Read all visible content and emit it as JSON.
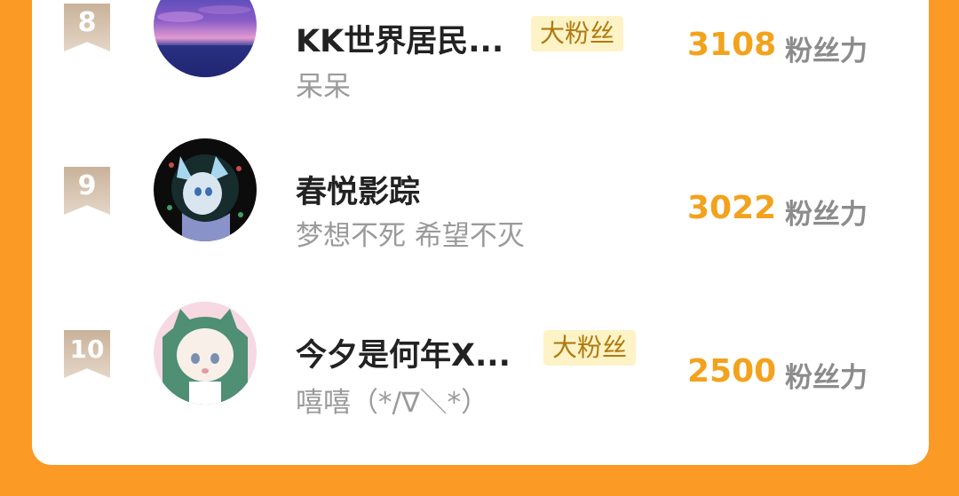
{
  "ranking": [
    {
      "rank": "8",
      "name": "KK世界居民...",
      "badge": "大粉丝",
      "subtitle": "呆呆",
      "score": "3108",
      "unit": "粉丝力"
    },
    {
      "rank": "9",
      "name": "春悦影踪",
      "badge": "",
      "subtitle": "梦想不死 希望不灭",
      "score": "3022",
      "unit": "粉丝力"
    },
    {
      "rank": "10",
      "name": "今夕是何年X...",
      "badge": "大粉丝",
      "subtitle": "嘻嘻（*/∇＼*）",
      "score": "2500",
      "unit": "粉丝力"
    }
  ]
}
